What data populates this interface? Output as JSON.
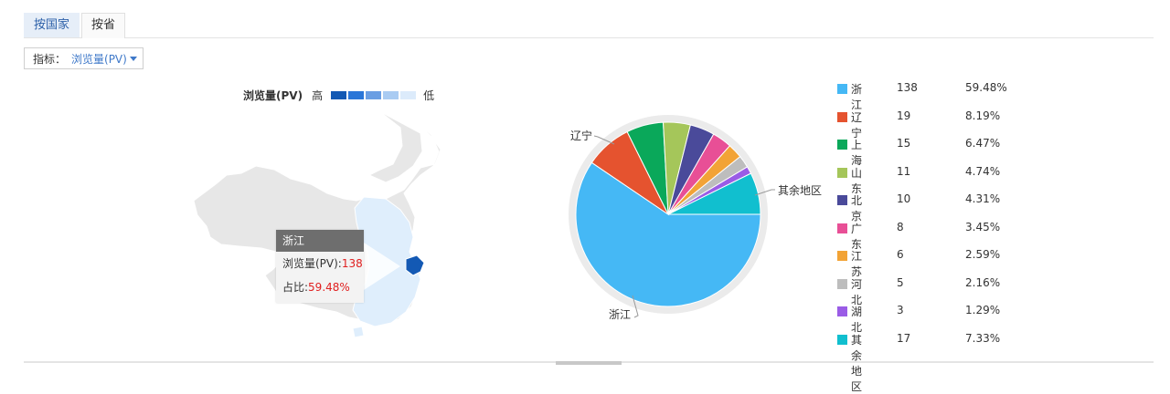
{
  "tabs": {
    "country": "按国家",
    "province": "按省"
  },
  "metric": {
    "label": "指标：",
    "value": "浏览量(PV)"
  },
  "map_legend": {
    "title": "浏览量(PV)",
    "high": "高",
    "low": "低",
    "colors": [
      "#1359b4",
      "#2a76d8",
      "#6a9ee3",
      "#a9cbf2",
      "#dcebfb"
    ]
  },
  "tooltip": {
    "name": "浙江",
    "pv_label": "浏览量(PV):",
    "pv_value": "138",
    "share_label": "占比:",
    "share_value": "59.48%"
  },
  "pie_labels": {
    "liaoning": "辽宁",
    "others": "其余地区",
    "zhejiang": "浙江"
  },
  "chart_data": {
    "type": "pie",
    "categories": [
      "浙江",
      "辽宁",
      "上海",
      "山东",
      "北京",
      "广东",
      "江苏",
      "河北",
      "湖北",
      "其余地区"
    ],
    "values": [
      138,
      19,
      15,
      11,
      10,
      8,
      6,
      5,
      3,
      17
    ],
    "percents": [
      "59.48%",
      "8.19%",
      "6.47%",
      "4.74%",
      "4.31%",
      "3.45%",
      "2.59%",
      "2.16%",
      "1.29%",
      "7.33%"
    ],
    "colors": [
      "#45b8f5",
      "#e5532f",
      "#0aa85a",
      "#a5c65a",
      "#4a4a9a",
      "#e84f96",
      "#f2a336",
      "#bdbdbd",
      "#9a5ce6",
      "#11bfcf"
    ]
  },
  "legend_rows": [
    {
      "name": "浙江",
      "count": "138",
      "pct": "59.48%"
    },
    {
      "name": "辽宁",
      "count": "19",
      "pct": "8.19%"
    },
    {
      "name": "上海",
      "count": "15",
      "pct": "6.47%"
    },
    {
      "name": "山东",
      "count": "11",
      "pct": "4.74%"
    },
    {
      "name": "北京",
      "count": "10",
      "pct": "4.31%"
    },
    {
      "name": "广东",
      "count": "8",
      "pct": "3.45%"
    },
    {
      "name": "江苏",
      "count": "6",
      "pct": "2.59%"
    },
    {
      "name": "河北",
      "count": "5",
      "pct": "2.16%"
    },
    {
      "name": "湖北",
      "count": "3",
      "pct": "1.29%"
    },
    {
      "name": "其余地区",
      "count": "17",
      "pct": "7.33%"
    }
  ]
}
